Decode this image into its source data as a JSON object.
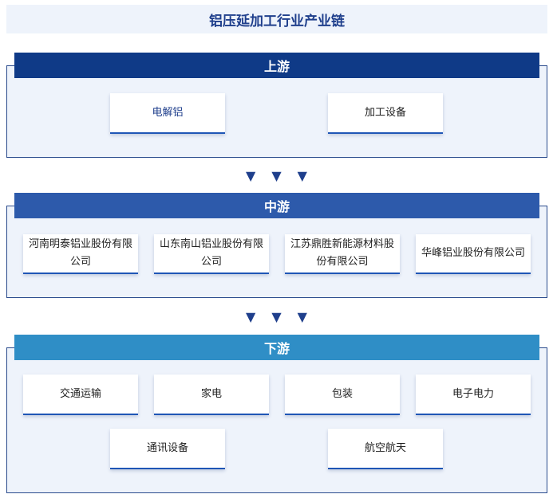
{
  "title": "铝压延加工行业产业链",
  "arrow_glyph": "▼",
  "colors": {
    "upstream": "#0f3a87",
    "midstream": "#2d5aab",
    "downstream": "#2f8ec6",
    "border": "#2a4b8d",
    "panel_bg": "#eef3fb"
  },
  "upstream": {
    "label": "上游",
    "items": [
      "电解铝",
      "加工设备"
    ]
  },
  "midstream": {
    "label": "中游",
    "items": [
      "河南明泰铝业股份有限公司",
      "山东南山铝业股份有限公司",
      "江苏鼎胜新能源材料股份有限公司",
      "华峰铝业股份有限公司"
    ]
  },
  "downstream": {
    "label": "下游",
    "items": [
      "交通运输",
      "家电",
      "包装",
      "电子电力",
      "通讯设备",
      "航空航天"
    ]
  }
}
